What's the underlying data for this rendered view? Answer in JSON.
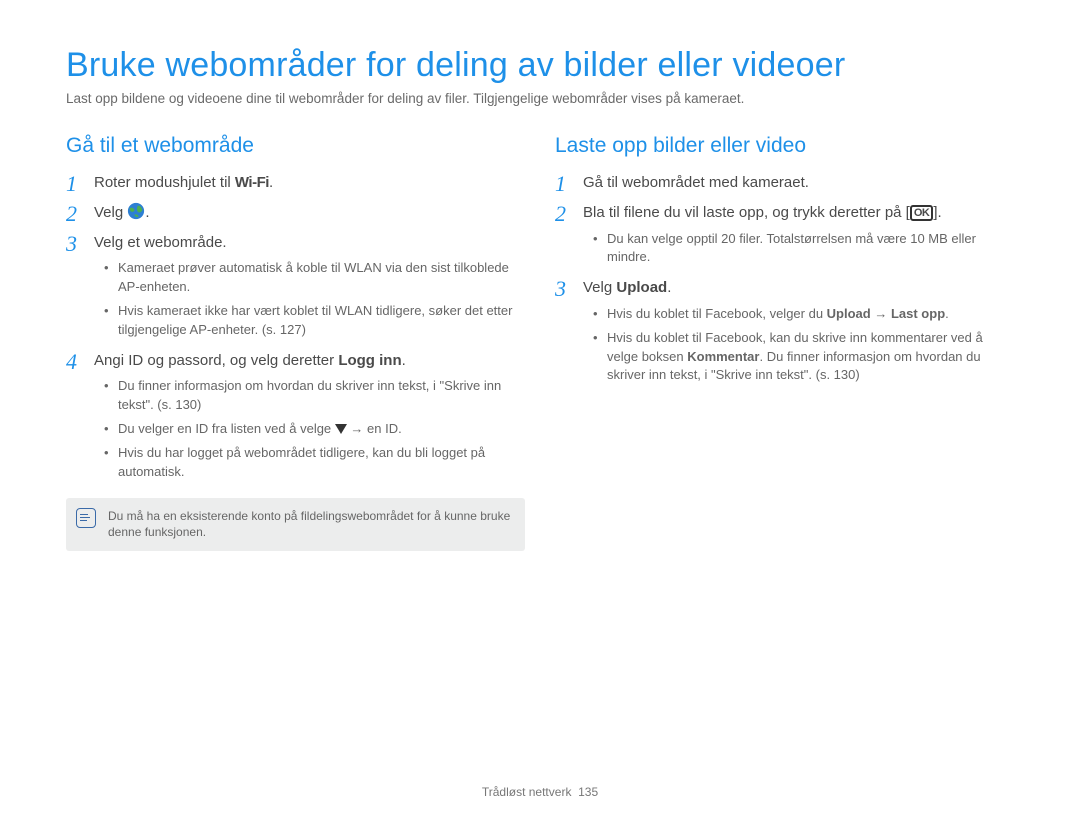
{
  "title": "Bruke webområder for deling av bilder eller videoer",
  "intro": "Last opp bildene og videoene dine til webområder for deling av filer. Tilgjengelige webområder vises på kameraet.",
  "left": {
    "heading": "Gå til et webområde",
    "step1_pre": "Roter modushjulet til ",
    "step1_wifi": "Wi-Fi",
    "step1_post": ".",
    "step2_pre": "Velg ",
    "step2_post": ".",
    "step3": "Velg et webområde.",
    "step3_sub1": "Kameraet prøver automatisk å koble til WLAN via den sist tilkoblede AP-enheten.",
    "step3_sub2": "Hvis kameraet ikke har vært koblet til WLAN tidligere, søker det etter tilgjengelige AP-enheter. (s. 127)",
    "step4_pre": "Angi ID og passord, og velg deretter ",
    "step4_bold": "Logg inn",
    "step4_post": ".",
    "step4_sub1": "Du finner informasjon om hvordan du skriver inn tekst, i \"Skrive inn tekst\". (s. 130)",
    "step4_sub2_pre": "Du velger en ID fra listen ved å velge ",
    "step4_sub2_post": " → en ID.",
    "step4_sub3": "Hvis du har logget på webområdet tidligere, kan du bli logget på automatisk.",
    "note": "Du må ha en eksisterende konto på fildelingswebområdet for å kunne bruke denne funksjonen."
  },
  "right": {
    "heading": "Laste opp bilder eller video",
    "step1": "Gå til webområdet med kameraet.",
    "step2_pre": "Bla til filene du vil laste opp, og trykk deretter på [",
    "step2_ok": "OK",
    "step2_post": "].",
    "step2_sub1": "Du kan velge opptil 20 filer. Totalstørrelsen må være 10 MB eller mindre.",
    "step3_pre": "Velg ",
    "step3_bold": "Upload",
    "step3_post": ".",
    "step3_sub1_pre": "Hvis du koblet til Facebook, velger du ",
    "step3_sub1_b1": "Upload",
    "step3_sub1_mid": " → ",
    "step3_sub1_b2": "Last opp",
    "step3_sub1_post": ".",
    "step3_sub2_pre": "Hvis du koblet til Facebook, kan du skrive inn kommentarer ved å velge boksen ",
    "step3_sub2_bold": "Kommentar",
    "step3_sub2_post": ". Du finner informasjon om hvordan du skriver inn tekst, i \"Skrive inn tekst\". (s. 130)"
  },
  "footer_label": "Trådløst nettverk",
  "footer_page": "135"
}
